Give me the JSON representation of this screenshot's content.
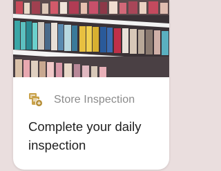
{
  "card": {
    "category": "Store Inspection",
    "category_icon": "store-inspection-icon",
    "title": "Complete your daily inspection",
    "image": "store-shelves-photo",
    "accent_color": "#c9a24a"
  }
}
